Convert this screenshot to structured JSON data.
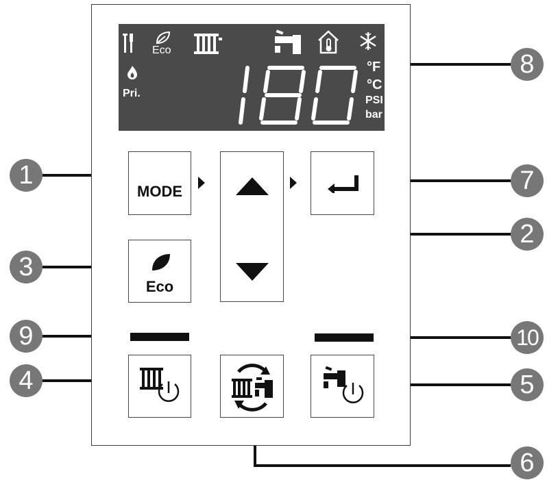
{
  "display": {
    "digits": "180",
    "eco_label": "Eco",
    "pri_label": "Pri.",
    "unit_f": "°F",
    "unit_c": "°C",
    "unit_psi": "PSI",
    "unit_bar": "bar"
  },
  "buttons": {
    "mode_label": "MODE",
    "eco_label": "Eco"
  },
  "callouts": {
    "c1": "1",
    "c2": "2",
    "c3": "3",
    "c4": "4",
    "c5": "5",
    "c6": "6",
    "c7": "7",
    "c8": "8",
    "c9": "9",
    "c10": "10"
  },
  "colors": {
    "lcd_background": "#4a4a4a",
    "callout": "#777777",
    "line": "#111111"
  }
}
